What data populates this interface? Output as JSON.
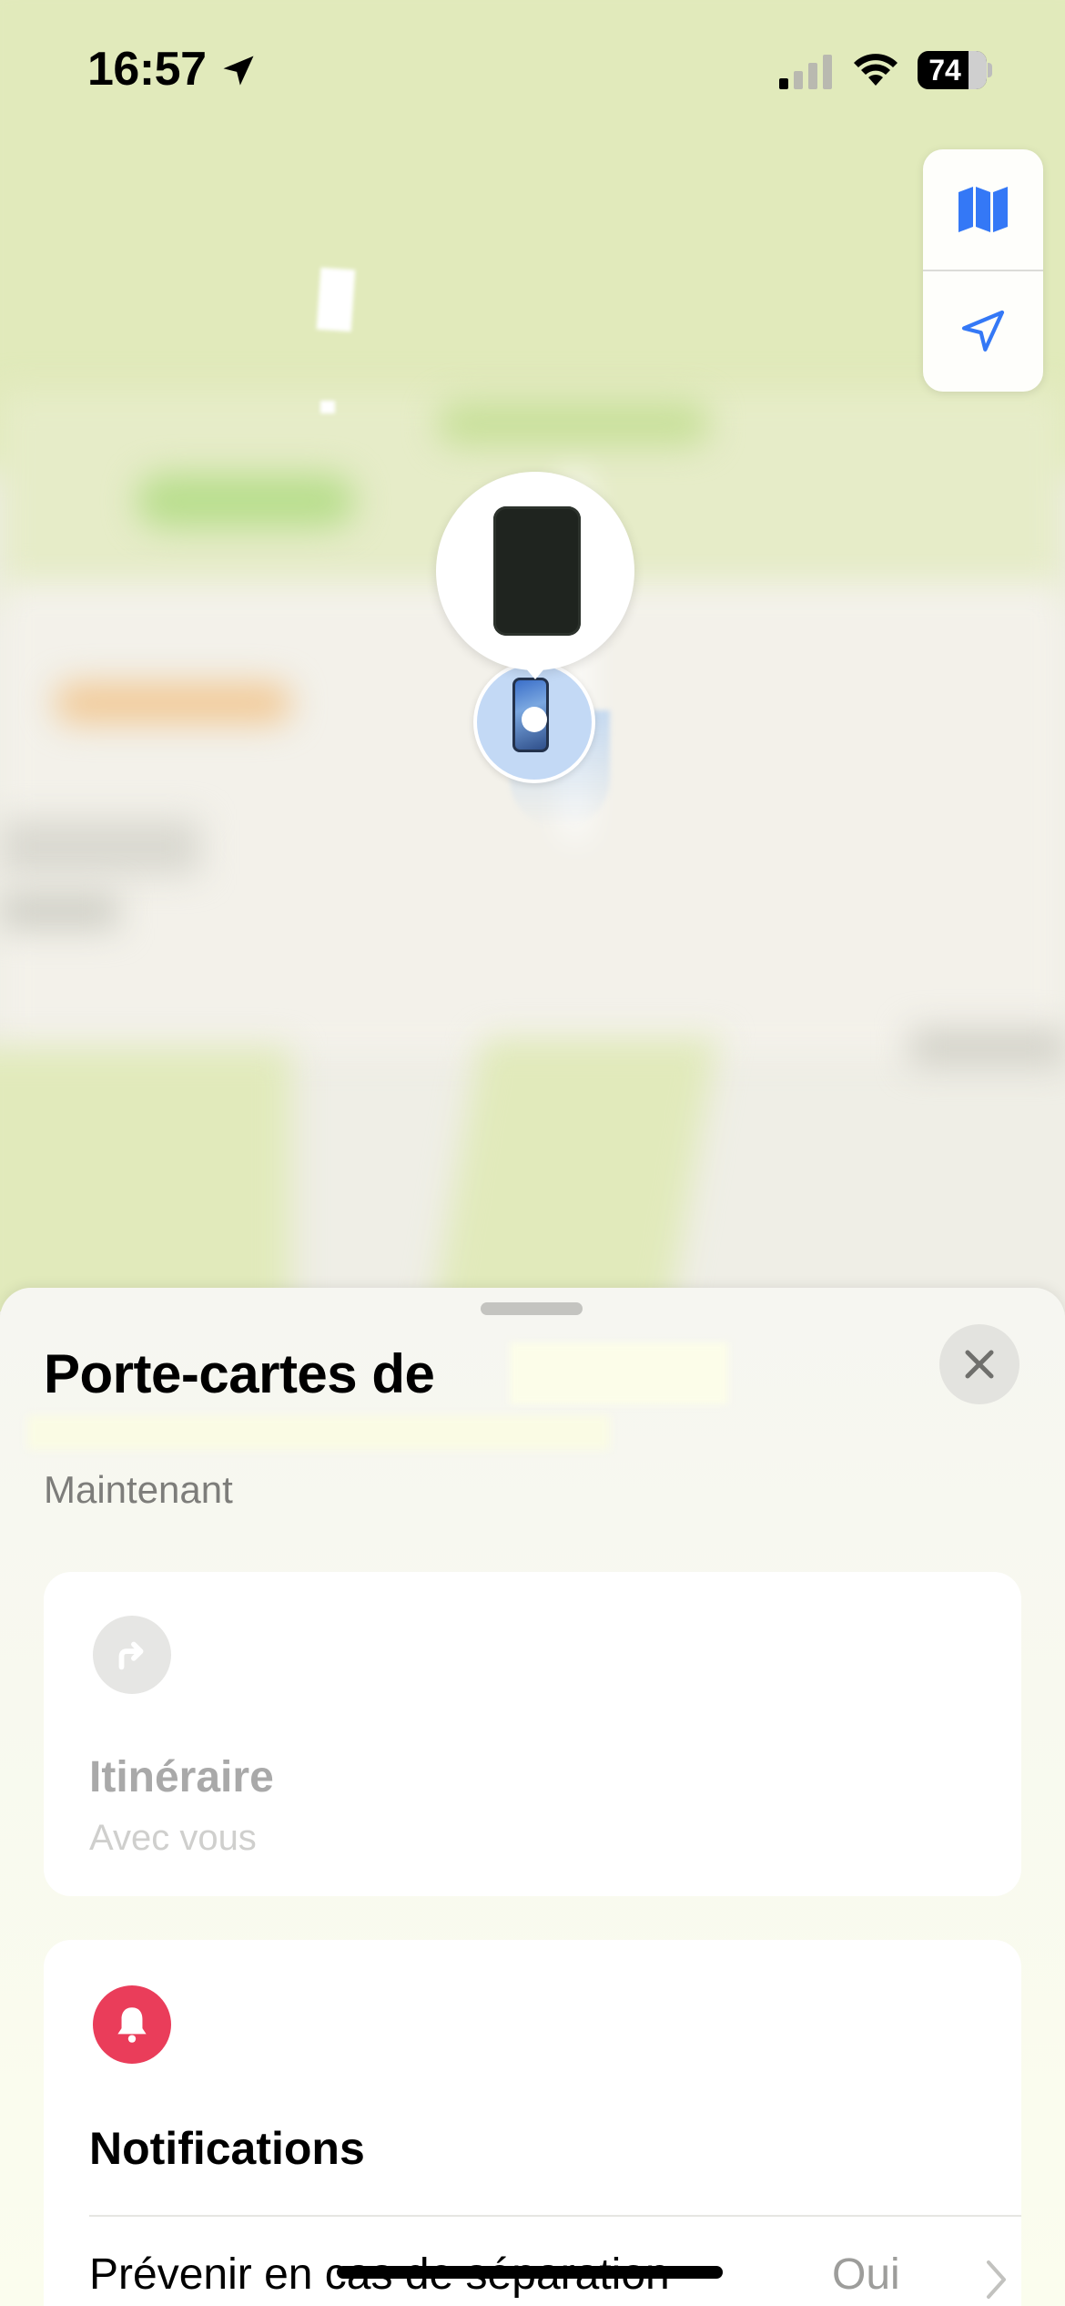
{
  "status_bar": {
    "time": "16:57",
    "battery": "74"
  },
  "map": {
    "controls": [
      {
        "name": "map-mode",
        "icon": "map-icon"
      },
      {
        "name": "locate-me",
        "icon": "location-arrow-icon"
      }
    ]
  },
  "sheet": {
    "title": "Porte-cartes de",
    "subtitle": "Maintenant",
    "directions": {
      "title": "Itinéraire",
      "subtitle": "Avec vous"
    },
    "notifications": {
      "title": "Notifications",
      "row_label": "Prévenir en cas de séparation",
      "row_value": "Oui"
    }
  },
  "colors": {
    "accent_blue": "#3478f6",
    "bell_red": "#ea3d5a",
    "park_green": "#e1eabb"
  }
}
